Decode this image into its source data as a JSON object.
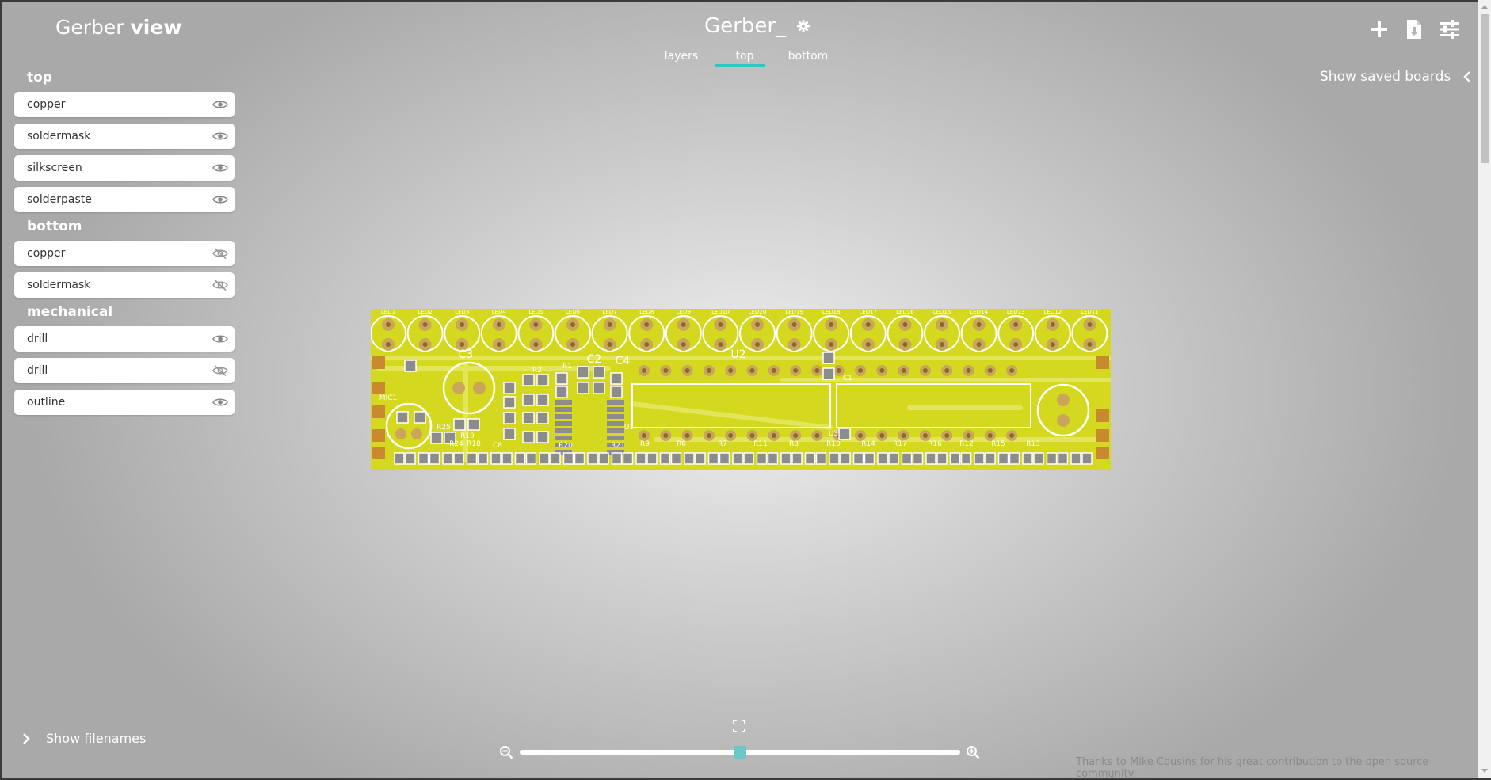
{
  "brand": {
    "name": "Gerber",
    "suffix": "view"
  },
  "document": {
    "title": "Gerber_"
  },
  "tabs": [
    {
      "label": "layers"
    },
    {
      "label": "top",
      "active": true
    },
    {
      "label": "bottom"
    }
  ],
  "saved_boards": {
    "label": "Show saved boards"
  },
  "sidebar": {
    "groups": [
      {
        "title": "top",
        "layers": [
          {
            "label": "copper",
            "visible": true
          },
          {
            "label": "soldermask",
            "visible": true
          },
          {
            "label": "silkscreen",
            "visible": true
          },
          {
            "label": "solderpaste",
            "visible": true
          }
        ]
      },
      {
        "title": "bottom",
        "layers": [
          {
            "label": "copper",
            "visible": false
          },
          {
            "label": "soldermask",
            "visible": false
          }
        ]
      },
      {
        "title": "mechanical",
        "layers": [
          {
            "label": "drill",
            "visible": true
          },
          {
            "label": "drill",
            "visible": false
          },
          {
            "label": "outline",
            "visible": true
          }
        ]
      }
    ]
  },
  "pcb": {
    "board_color": "#d4d81f",
    "pad_color": "#c9a65a",
    "led_labels": [
      "LED1",
      "LED2",
      "LED3",
      "LED4",
      "LED5",
      "LED6",
      "LED7",
      "LED8",
      "LED9",
      "LED10",
      "LED20",
      "LED19",
      "LED18",
      "LED17",
      "LED16",
      "LED15",
      "LED14",
      "LED13",
      "LED12",
      "LED11"
    ],
    "component_labels": [
      "C3",
      "R2",
      "R1",
      "C2",
      "C4",
      "U2",
      "C1",
      "U1",
      "U3",
      "R25",
      "R19",
      "R24",
      "R18",
      "C8",
      "R20",
      "R21",
      "R9",
      "R6",
      "R7",
      "R11",
      "R8",
      "R10",
      "R14",
      "R17",
      "R16",
      "R12",
      "R15",
      "R13",
      "MIC1"
    ]
  },
  "footer": {
    "show_filenames": "Show filenames",
    "credits": "Thanks to Mike Cousins for his great contribution to the open source community."
  },
  "zoom": {
    "level": 0.5
  },
  "colors": {
    "accent": "#35c2c2"
  }
}
